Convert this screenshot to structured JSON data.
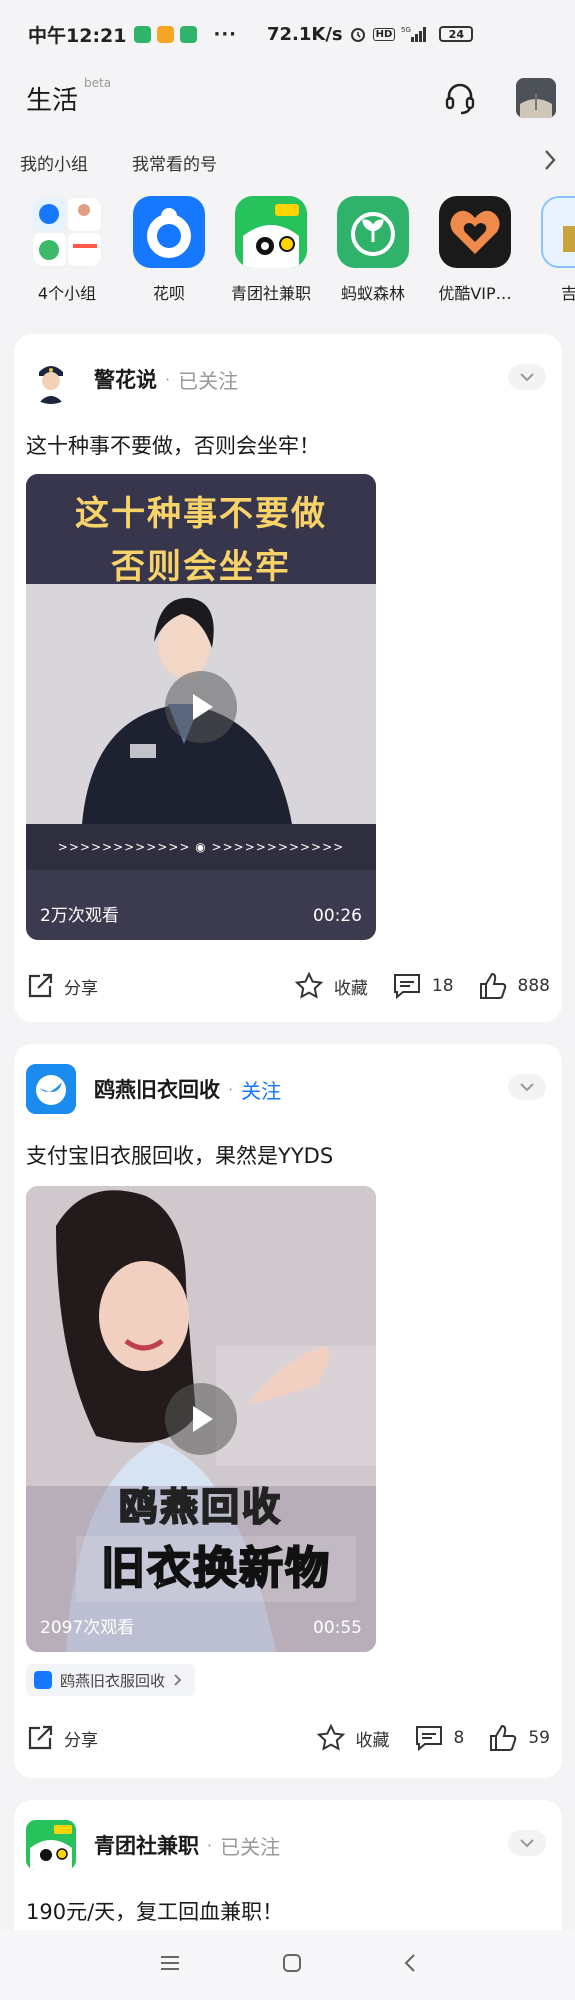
{
  "status_bar": {
    "time": "中午12:21",
    "net_speed": "72.1K/s",
    "battery": "24"
  },
  "header": {
    "title": "生活",
    "badge": "beta"
  },
  "sections": {
    "my_groups": "我的小组",
    "frequently_viewed": "我常看的号"
  },
  "apps": [
    {
      "label": "4个小组",
      "icon": "groups-collage-icon"
    },
    {
      "label": "花呗",
      "icon": "huabei-icon"
    },
    {
      "label": "青团社兼职",
      "icon": "qingtuanshe-icon"
    },
    {
      "label": "蚂蚁森林",
      "icon": "ant-forest-icon"
    },
    {
      "label": "优酷VIP…",
      "icon": "youku-vip-icon"
    },
    {
      "label": "吉吉",
      "icon": "partial-app-icon"
    }
  ],
  "posts": [
    {
      "author": "警花说",
      "follow_state": "已关注",
      "text": "这十种事不要做，否则会坐牢！",
      "video_title_line1": "这十种事不要做",
      "video_title_line2": "否则会坐牢",
      "views": "2万次观看",
      "duration": "00:26",
      "share": "分享",
      "favorite": "收藏",
      "comments": "18",
      "likes": "888"
    },
    {
      "author": "鸥燕旧衣回收",
      "follow_state": "关注",
      "text": "支付宝旧衣服回收，果然是YYDS",
      "video_caption_line1": "鸥燕回收",
      "video_caption_line2": "旧衣换新物",
      "views": "2097次观看",
      "duration": "00:55",
      "mini_program": "鸥燕旧衣服回收",
      "share": "分享",
      "favorite": "收藏",
      "comments": "8",
      "likes": "59"
    },
    {
      "author": "青团社兼职",
      "follow_state": "已关注",
      "text": "190元/天，复工回血兼职！"
    }
  ],
  "colors": {
    "accent_blue": "#1677ff",
    "page_bg": "#f4f4f6"
  }
}
